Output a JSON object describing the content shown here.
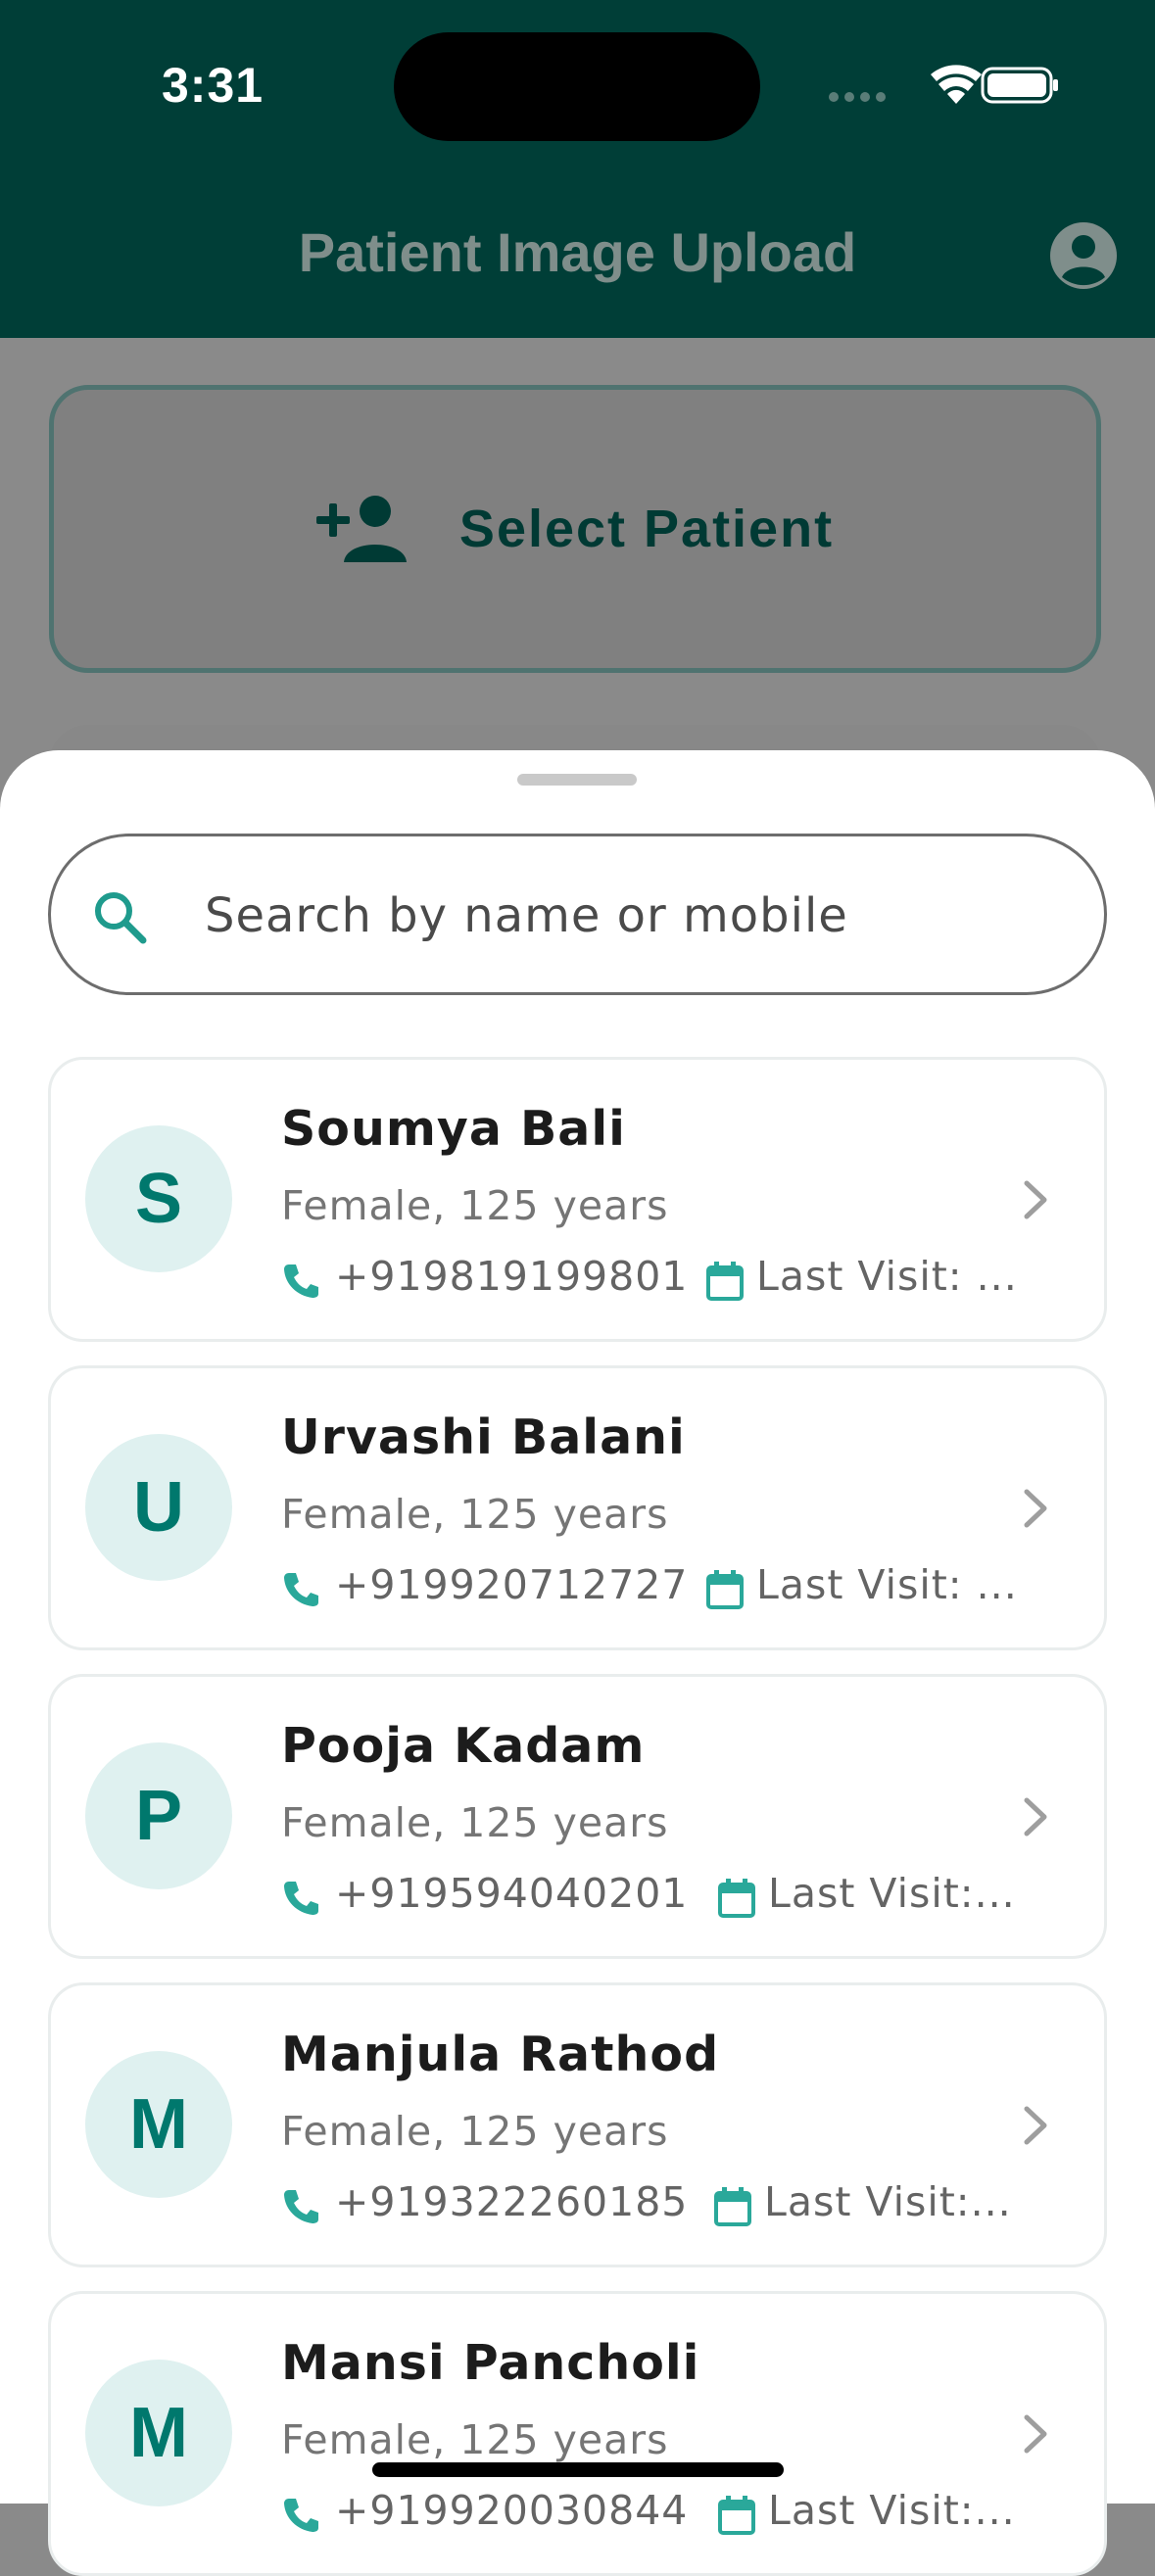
{
  "status_bar": {
    "time": "3:31"
  },
  "header": {
    "title": "Patient Image Upload"
  },
  "background": {
    "select_patient_label": "Select Patient"
  },
  "search": {
    "placeholder": "Search by name or mobile",
    "value": ""
  },
  "patients": [
    {
      "initial": "S",
      "name": "Soumya Bali",
      "meta": "Female, 125 years",
      "phone": "+919819199801",
      "last_visit": "Last Visit: ..."
    },
    {
      "initial": "U",
      "name": "Urvashi Balani",
      "meta": "Female, 125 years",
      "phone": "+919920712727",
      "last_visit": "Last Visit: ..."
    },
    {
      "initial": "P",
      "name": "Pooja Kadam",
      "meta": "Female, 125 years",
      "phone": "+919594040201",
      "last_visit": "Last Visit:..."
    },
    {
      "initial": "M",
      "name": "Manjula Rathod",
      "meta": "Female, 125 years",
      "phone": "+919322260185",
      "last_visit": "Last Visit:..."
    },
    {
      "initial": "M",
      "name": "Mansi Pancholi",
      "meta": "Female, 125 years",
      "phone": "+919920030844",
      "last_visit": "Last Visit:..."
    }
  ],
  "colors": {
    "header_bg": "#003e37",
    "accent_teal": "#00786d",
    "avatar_bg": "#dff1f0",
    "icon_teal": "#2aa89a"
  },
  "icons": {
    "profile": "account-circle-icon",
    "add_person": "person-add-icon",
    "search": "search-icon",
    "phone": "phone-icon",
    "calendar": "calendar-icon",
    "chevron": "chevron-right-icon"
  }
}
